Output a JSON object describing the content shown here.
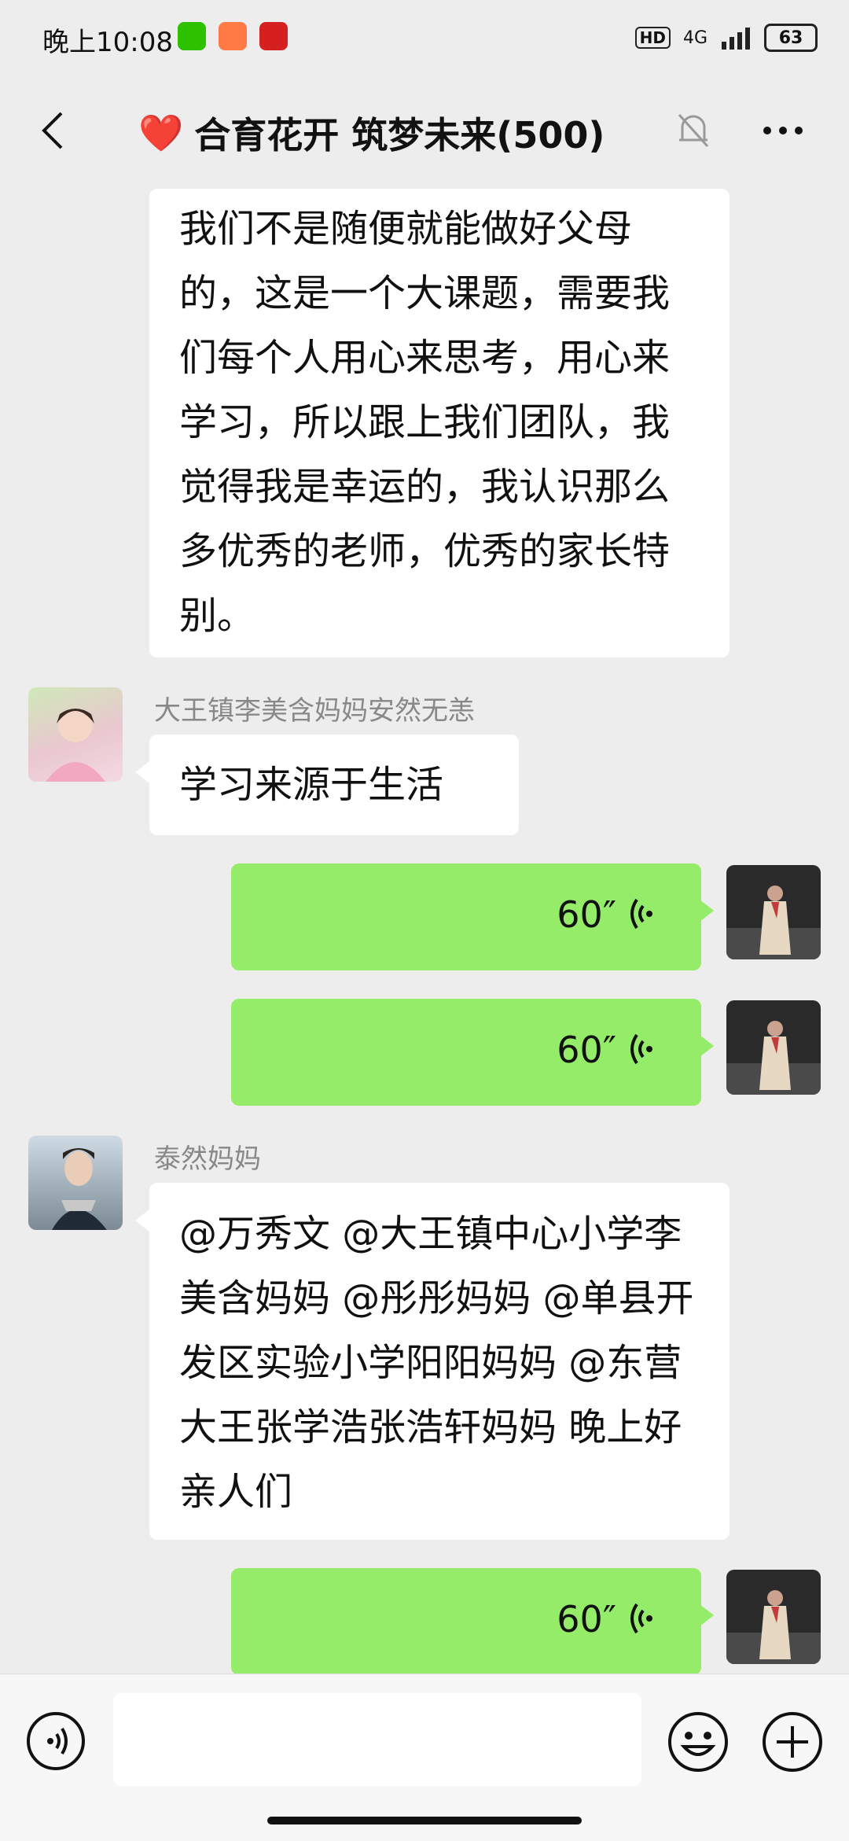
{
  "status_bar": {
    "time": "晚上10:08",
    "hd": "HD",
    "network": "4G",
    "battery": "63"
  },
  "header": {
    "title": "合育花开 筑梦未来(500)",
    "emoji": "❤️"
  },
  "messages": [
    {
      "type": "text",
      "side": "left",
      "text": "我们不是随便就能做好父母的，这是一个大课题，需要我们每个人用心来思考，用心来学习，所以跟上我们团队，我觉得我是幸运的，我认识那么多优秀的老师，优秀的家长特别。"
    },
    {
      "type": "text",
      "side": "left",
      "sender": "大王镇李美含妈妈安然无恙",
      "text": "学习来源于生活"
    },
    {
      "type": "voice",
      "side": "right",
      "duration": "60″"
    },
    {
      "type": "voice",
      "side": "right",
      "duration": "60″"
    },
    {
      "type": "text",
      "side": "left",
      "sender": "泰然妈妈",
      "text": "@万秀文 @大王镇中心小学李美含妈妈 @彤彤妈妈 @单县开发区实验小学阳阳妈妈 @东营大王张学浩张浩轩妈妈 晚上好亲人们"
    },
    {
      "type": "voice",
      "side": "right",
      "duration": "60″"
    }
  ],
  "input_bar": {
    "placeholder": ""
  },
  "colors": {
    "chat_bg": "#ededed",
    "green_bubble": "#95ec69",
    "white_bubble": "#ffffff"
  }
}
